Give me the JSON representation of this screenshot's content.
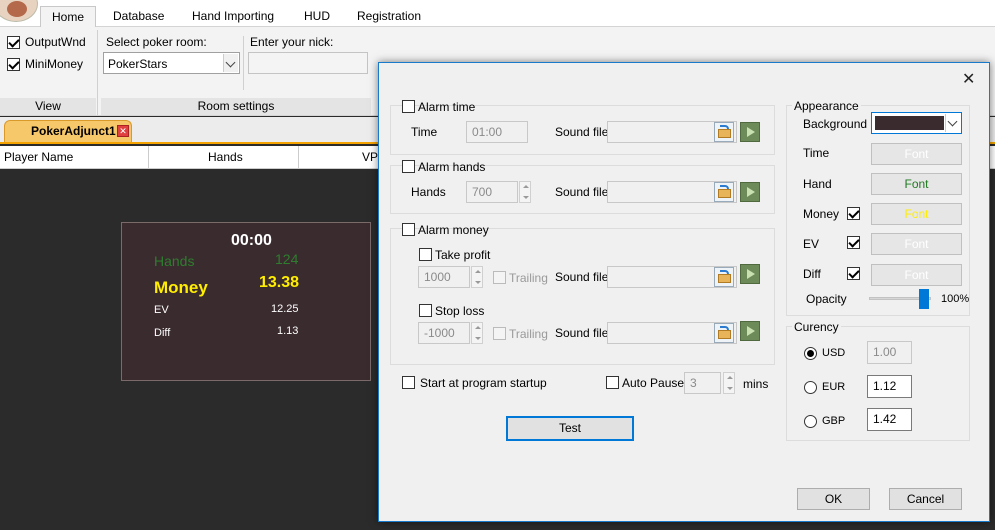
{
  "ribbon": {
    "tabs": [
      "Home",
      "Database",
      "Hand Importing",
      "HUD",
      "Registration"
    ],
    "view": {
      "output_wnd": "OutputWnd",
      "mini_money": "MiniMoney",
      "group_label": "View"
    },
    "room": {
      "select_label": "Select poker room:",
      "room_value": "PokerStars",
      "nick_label": "Enter your nick:",
      "nick_value": "",
      "group_label": "Room settings"
    }
  },
  "doc_tab": {
    "label": "PokerAdjunct1"
  },
  "grid": {
    "columns": [
      "Player Name",
      "Hands",
      "VPI"
    ]
  },
  "mini": {
    "time": "00:00",
    "hands_label": "Hands",
    "hands_value": "124",
    "money_label": "Money",
    "money_value": "13.38",
    "ev_label": "EV",
    "ev_value": "12.25",
    "diff_label": "Diff",
    "diff_value": "1.13"
  },
  "dialog": {
    "close": "✕",
    "alarm_time": {
      "label": "Alarm time",
      "time_label": "Time",
      "time_value": "01:00",
      "sound_label": "Sound file",
      "sound_value": ""
    },
    "alarm_hands": {
      "label": "Alarm hands",
      "hands_label": "Hands",
      "hands_value": "700",
      "sound_label": "Sound file",
      "sound_value": ""
    },
    "alarm_money": {
      "label": "Alarm money",
      "take_profit": "Take profit",
      "tp_value": "1000",
      "trailing1": "Trailing",
      "sound1": "Sound file",
      "stop_loss": "Stop loss",
      "sl_value": "-1000",
      "trailing2": "Trailing",
      "sound2": "Sound file"
    },
    "startup": "Start at program startup",
    "auto_pause": "Auto Pause",
    "auto_pause_value": "3",
    "mins": "mins",
    "test": "Test",
    "appearance": {
      "title": "Appearance",
      "background": "Background",
      "background_color": "#3a2b2f",
      "time": "Time",
      "hand": "Hand",
      "money": "Money",
      "ev": "EV",
      "diff": "Diff",
      "font": "Font",
      "opacity": "Opacity",
      "opacity_value": "100%",
      "opacity_level": 1.0
    },
    "currency": {
      "title": "Curency",
      "usd": "USD",
      "usd_value": "1.00",
      "eur": "EUR",
      "eur_value": "1.12",
      "gbp": "GBP",
      "gbp_value": "1.42"
    },
    "ok": "OK",
    "cancel": "Cancel"
  }
}
